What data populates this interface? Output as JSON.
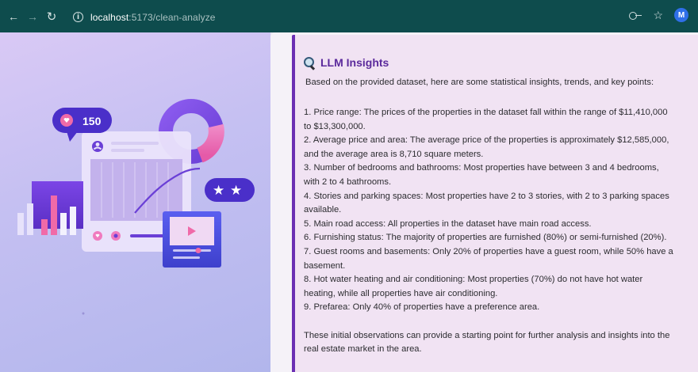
{
  "browser": {
    "url_host": "localhost",
    "url_path": ":5173/clean-analyze",
    "profile_initial": "M"
  },
  "illustration": {
    "like_count": "150"
  },
  "insights": {
    "title": "LLM Insights",
    "intro": "Based on the provided dataset, here are some statistical insights, trends, and key points:",
    "findings": [
      "1. Price range: The prices of the properties in the dataset fall within the range of $11,410,000 to $13,300,000.",
      "2. Average price and area: The average price of the properties is approximately $12,585,000, and the average area is 8,710 square meters.",
      "3. Number of bedrooms and bathrooms: Most properties have between 3 and 4 bedrooms, with 2 to 4 bathrooms.",
      "4. Stories and parking spaces: Most properties have 2 to 3 stories, with 2 to 3 parking spaces available.",
      "5. Main road access: All properties in the dataset have main road access.",
      "6. Furnishing status: The majority of properties are furnished (80%) or semi-furnished (20%).",
      "7. Guest rooms and basements: Only 20% of properties have a guest room, while 50% have a basement.",
      "8. Hot water heating and air conditioning: Most properties (70%) do not have hot water heating, while all properties have air conditioning.",
      "9. Prefarea: Only 40% of properties have a preference area."
    ],
    "conclusion": "These initial observations can provide a starting point for further analysis and insights into the real estate market in the area."
  },
  "colors": {
    "chrome": "#0e4c4d",
    "accent": "#6b2fb3",
    "card_bg": "#f1e3f3"
  }
}
